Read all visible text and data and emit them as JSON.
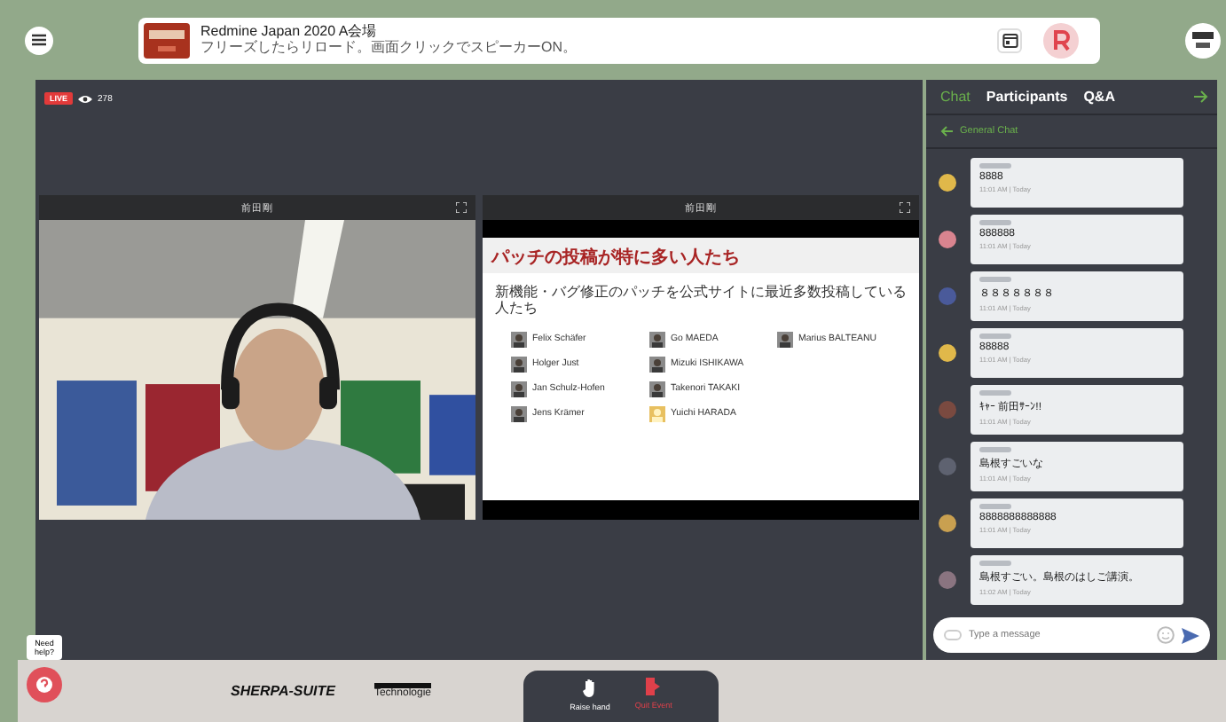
{
  "header": {
    "title": "Redmine Japan 2020 A会場",
    "subtitle": "フリーズしたらリロード。画面クリックでスピーカーON。"
  },
  "live": {
    "badge": "LIVE",
    "viewers": "278"
  },
  "videos": [
    {
      "name": "前田剛",
      "kind": "camera"
    },
    {
      "name": "前田剛",
      "kind": "slide"
    }
  ],
  "slide": {
    "title": "パッチの投稿が特に多い人たち",
    "subtitle": "新機能・バグ修正のパッチを公式サイトに最近多数投稿している人たち",
    "people": [
      "Felix Schäfer",
      "Holger Just",
      "Jan Schulz-Hofen",
      "Jens Krämer",
      "Go MAEDA",
      "Mizuki ISHIKAWA",
      "Takenori TAKAKI",
      "Yuichi HARADA",
      "Marius BALTEANU"
    ]
  },
  "chat": {
    "tabs": [
      {
        "label": "Chat",
        "selected": true
      },
      {
        "label": "Participants",
        "selected": false
      },
      {
        "label": "Q&A",
        "selected": false
      }
    ],
    "channel": "General Chat",
    "messages": [
      {
        "text": "8888",
        "time": "11:01 AM | Today",
        "color": "#e0b84a"
      },
      {
        "text": "888888",
        "time": "11:01 AM | Today",
        "color": "#d9848f"
      },
      {
        "text": "８８８８８８８",
        "time": "11:01 AM | Today",
        "color": "#4a5a9a"
      },
      {
        "text": "88888",
        "time": "11:01 AM | Today",
        "color": "#e0b84a"
      },
      {
        "text": "ｷｬｰ 前田ｻｰﾝ!!",
        "time": "11:01 AM | Today",
        "color": "#7a4a40"
      },
      {
        "text": "島根すごいな",
        "time": "11:01 AM | Today",
        "color": "#5e6270"
      },
      {
        "text": "8888888888888",
        "time": "11:01 AM | Today",
        "color": "#c9a050"
      },
      {
        "text": "島根すごい。島根のはしご講演。",
        "time": "11:02 AM | Today",
        "color": "#8a7480"
      }
    ],
    "input": {
      "placeholder": "Type a message"
    }
  },
  "sponsors": [
    "SHERPA-SUITE",
    "Technologie"
  ],
  "help": {
    "label": "Need help?"
  },
  "controls": [
    {
      "label": "Raise hand",
      "kind": "raise"
    },
    {
      "label": "Quit Event",
      "kind": "quit"
    }
  ]
}
